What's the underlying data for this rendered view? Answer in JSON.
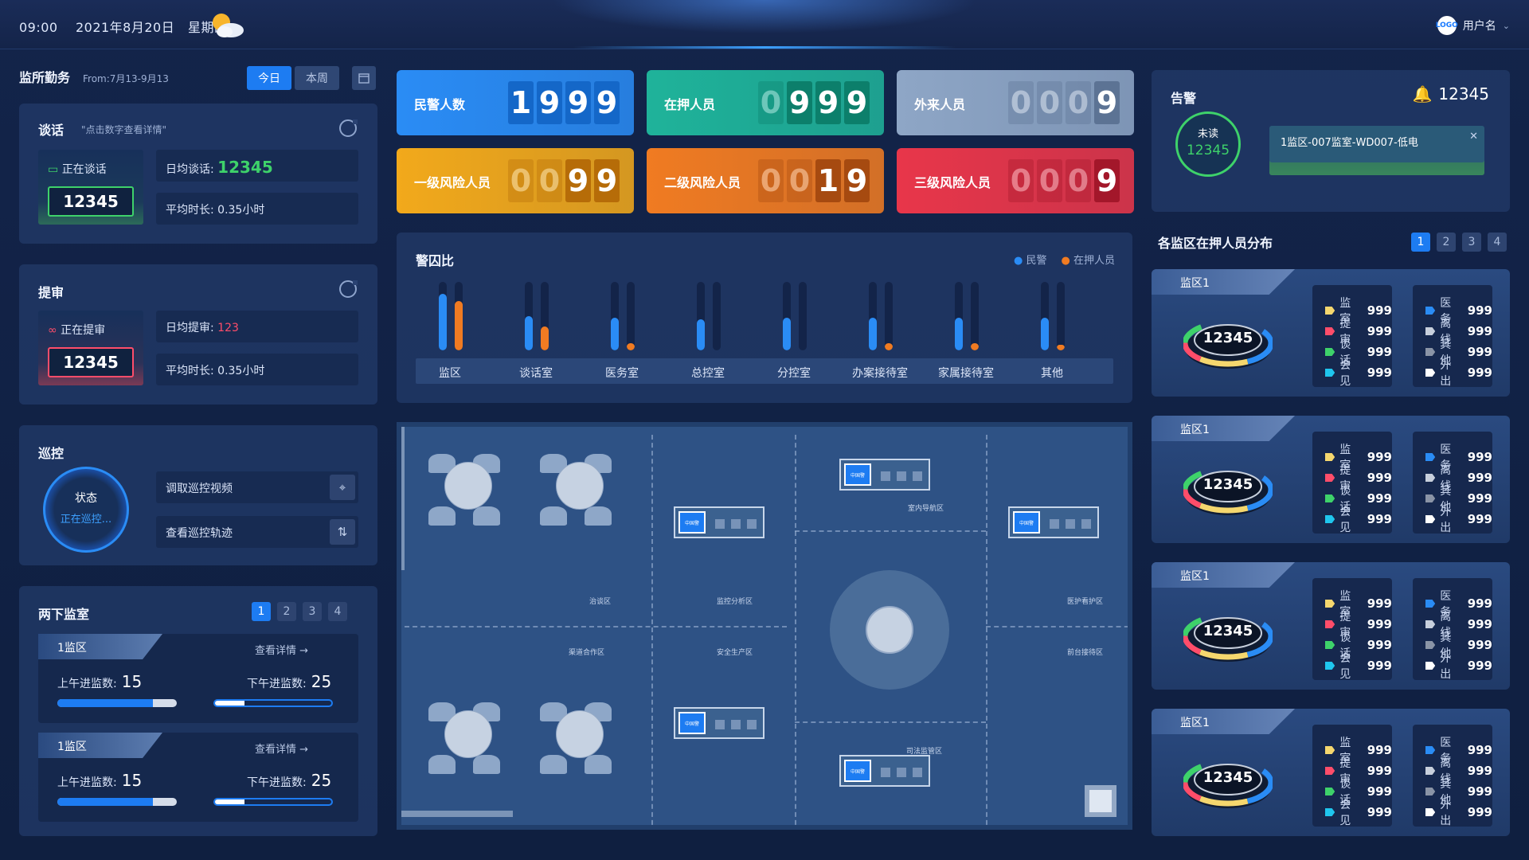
{
  "header": {
    "time": "09:00",
    "date": "2021年8月20日",
    "weekday": "星期四",
    "weather_icon": "partly-cloudy-icon",
    "avatar_text": "LOGO",
    "username": "用户名"
  },
  "duty": {
    "title": "监所勤务",
    "range": "From:7月13-9月13",
    "tabs": [
      "今日",
      "本周"
    ]
  },
  "talk": {
    "title": "谈话",
    "hint": "\"点击数字查看详情\"",
    "status_label": "正在谈话",
    "count": "12345",
    "daily_label": "日均谈话:",
    "daily_value": "12345",
    "avg_label": "平均时长: 0.35小时"
  },
  "review": {
    "title": "提审",
    "status_label": "正在提审",
    "count": "12345",
    "daily_label": "日均提审:",
    "daily_value": "123",
    "avg_label": "平均时长: 0.35小时"
  },
  "patrol": {
    "title": "巡控",
    "ring_title": "状态",
    "ring_status": "正在巡控...",
    "btn_video": "调取巡控视频",
    "btn_track": "查看巡控轨迹"
  },
  "cells": {
    "title": "两下监室",
    "pages": [
      "1",
      "2",
      "3",
      "4"
    ],
    "items": [
      {
        "name": "1监区",
        "detail": "查看详情 →",
        "am_label": "上午进监数:",
        "am_value": "15",
        "pm_label": "下午进监数:",
        "pm_value": "25",
        "am_fill": 0.8,
        "pm_fill": 0.25
      },
      {
        "name": "1监区",
        "detail": "查看详情 →",
        "am_label": "上午进监数:",
        "am_value": "15",
        "pm_label": "下午进监数:",
        "pm_value": "25",
        "am_fill": 0.8,
        "pm_fill": 0.25
      }
    ]
  },
  "kpis": [
    {
      "label": "民警人数",
      "digits": [
        "1",
        "9",
        "9",
        "9"
      ],
      "dim": [
        false,
        false,
        false,
        false
      ],
      "color": "#2a8cf5",
      "digit_bg": "#1467c8"
    },
    {
      "label": "在押人员",
      "digits": [
        "0",
        "9",
        "9",
        "9"
      ],
      "dim": [
        true,
        false,
        false,
        false
      ],
      "color": "#1fb39a",
      "digit_bg": "#0c7f6b"
    },
    {
      "label": "外来人员",
      "digits": [
        "0",
        "0",
        "0",
        "9"
      ],
      "dim": [
        true,
        true,
        true,
        false
      ],
      "color": "#8ea6c6",
      "digit_bg": "#5c7394"
    },
    {
      "label": "一级风险人员",
      "digits": [
        "0",
        "0",
        "9",
        "9"
      ],
      "dim": [
        true,
        true,
        false,
        false
      ],
      "color": "#f2a91b",
      "digit_bg": "#b66c08"
    },
    {
      "label": "二级风险人员",
      "digits": [
        "0",
        "0",
        "1",
        "9"
      ],
      "dim": [
        true,
        true,
        false,
        false
      ],
      "color": "#f07b22",
      "digit_bg": "#a64a10"
    },
    {
      "label": "三级风险人员",
      "digits": [
        "0",
        "0",
        "0",
        "9"
      ],
      "dim": [
        true,
        true,
        true,
        false
      ],
      "color": "#e8364a",
      "digit_bg": "#a3172a"
    }
  ],
  "chart_data": {
    "type": "bar",
    "title": "警囚比",
    "categories": [
      "监区",
      "谈话室",
      "医务室",
      "总控室",
      "分控室",
      "办案接待室",
      "家属接待室",
      "其他"
    ],
    "series": [
      {
        "name": "民警",
        "color": "#2a8cf5",
        "values": [
          82,
          50,
          48,
          45,
          48,
          48,
          48,
          48
        ]
      },
      {
        "name": "在押人员",
        "color": "#f07b22",
        "values": [
          72,
          35,
          10,
          0,
          0,
          10,
          10,
          8
        ]
      }
    ],
    "ylim": [
      0,
      100
    ]
  },
  "map": {
    "labels": [
      "室内导航区",
      "监控分析区",
      "治谈区",
      "医护看护区",
      "渠道合作区",
      "安全生产区",
      "前台接待区",
      "司法监管区"
    ],
    "screen_text": "中国警"
  },
  "alarm": {
    "title": "告警",
    "count": "12345",
    "unread_label": "未读",
    "unread_value": "12345",
    "message": "1监区-007监室-WD007-低电"
  },
  "distribution": {
    "title": "各监区在押人员分布",
    "pages": [
      "1",
      "2",
      "3",
      "4"
    ],
    "cards": [
      {
        "name": "监区1",
        "center": "12345",
        "left": [
          {
            "label": "监室",
            "value": "999",
            "color": "#f5d76e"
          },
          {
            "label": "提审",
            "value": "999",
            "color": "#ff4d6a"
          },
          {
            "label": "谈话",
            "value": "999",
            "color": "#3ed26a"
          },
          {
            "label": "会见",
            "value": "999",
            "color": "#1fc6ee"
          }
        ],
        "right": [
          {
            "label": "医务",
            "value": "999",
            "color": "#2a8cf5"
          },
          {
            "label": "离线",
            "value": "999",
            "color": "#c7cfdc"
          },
          {
            "label": "其他",
            "value": "999",
            "color": "#8a94a6"
          },
          {
            "label": "外出",
            "value": "999",
            "color": "#ffffff"
          }
        ]
      },
      {
        "name": "监区1",
        "center": "12345",
        "left": [
          {
            "label": "监室",
            "value": "999",
            "color": "#f5d76e"
          },
          {
            "label": "提审",
            "value": "999",
            "color": "#ff4d6a"
          },
          {
            "label": "谈话",
            "value": "999",
            "color": "#3ed26a"
          },
          {
            "label": "会见",
            "value": "999",
            "color": "#1fc6ee"
          }
        ],
        "right": [
          {
            "label": "医务",
            "value": "999",
            "color": "#2a8cf5"
          },
          {
            "label": "离线",
            "value": "999",
            "color": "#c7cfdc"
          },
          {
            "label": "其他",
            "value": "999",
            "color": "#8a94a6"
          },
          {
            "label": "外出",
            "value": "999",
            "color": "#ffffff"
          }
        ]
      },
      {
        "name": "监区1",
        "center": "12345",
        "left": [
          {
            "label": "监室",
            "value": "999",
            "color": "#f5d76e"
          },
          {
            "label": "提审",
            "value": "999",
            "color": "#ff4d6a"
          },
          {
            "label": "谈话",
            "value": "999",
            "color": "#3ed26a"
          },
          {
            "label": "会见",
            "value": "999",
            "color": "#1fc6ee"
          }
        ],
        "right": [
          {
            "label": "医务",
            "value": "999",
            "color": "#2a8cf5"
          },
          {
            "label": "离线",
            "value": "999",
            "color": "#c7cfdc"
          },
          {
            "label": "其他",
            "value": "999",
            "color": "#8a94a6"
          },
          {
            "label": "外出",
            "value": "999",
            "color": "#ffffff"
          }
        ]
      },
      {
        "name": "监区1",
        "center": "12345",
        "left": [
          {
            "label": "监室",
            "value": "999",
            "color": "#f5d76e"
          },
          {
            "label": "提审",
            "value": "999",
            "color": "#ff4d6a"
          },
          {
            "label": "谈话",
            "value": "999",
            "color": "#3ed26a"
          },
          {
            "label": "会见",
            "value": "999",
            "color": "#1fc6ee"
          }
        ],
        "right": [
          {
            "label": "医务",
            "value": "999",
            "color": "#2a8cf5"
          },
          {
            "label": "离线",
            "value": "999",
            "color": "#c7cfdc"
          },
          {
            "label": "其他",
            "value": "999",
            "color": "#8a94a6"
          },
          {
            "label": "外出",
            "value": "999",
            "color": "#ffffff"
          }
        ]
      }
    ]
  }
}
